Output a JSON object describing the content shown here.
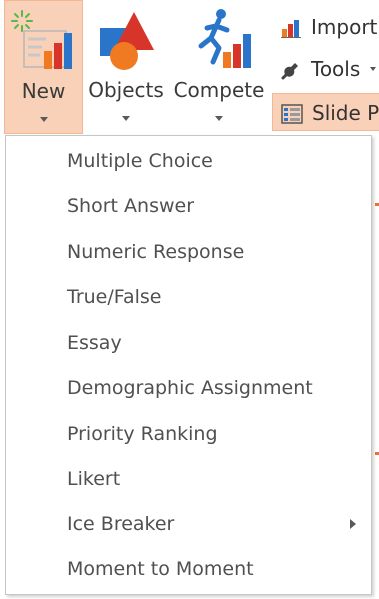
{
  "ribbon": {
    "new_label": "New",
    "objects_label": "Objects",
    "compete_label": "Compete",
    "import_label": "Import",
    "tools_label": "Tools",
    "slide_label": "Slide P"
  },
  "menu": {
    "items": [
      {
        "label": "Multiple Choice"
      },
      {
        "label": "Short Answer"
      },
      {
        "label": "Numeric Response"
      },
      {
        "label": "True/False"
      },
      {
        "label": "Essay"
      },
      {
        "label": "Demographic Assignment"
      },
      {
        "label": "Priority Ranking"
      },
      {
        "label": "Likert"
      },
      {
        "label": "Ice Breaker",
        "has_submenu": true
      },
      {
        "label": "Moment to Moment"
      }
    ]
  },
  "colors": {
    "selected_bg": "#f9d1b9",
    "selected_border": "#f4b796",
    "accent_orange": "#f07a22",
    "accent_red": "#d8352a",
    "accent_blue": "#2a75c9"
  },
  "icons": {
    "new": "new-question-chart-icon",
    "objects": "shapes-icon",
    "compete": "runner-chart-icon",
    "import": "bar-chart-icon",
    "tools": "wrench-icon",
    "slide": "slide-list-icon",
    "submenu": "chevron-right-icon"
  }
}
